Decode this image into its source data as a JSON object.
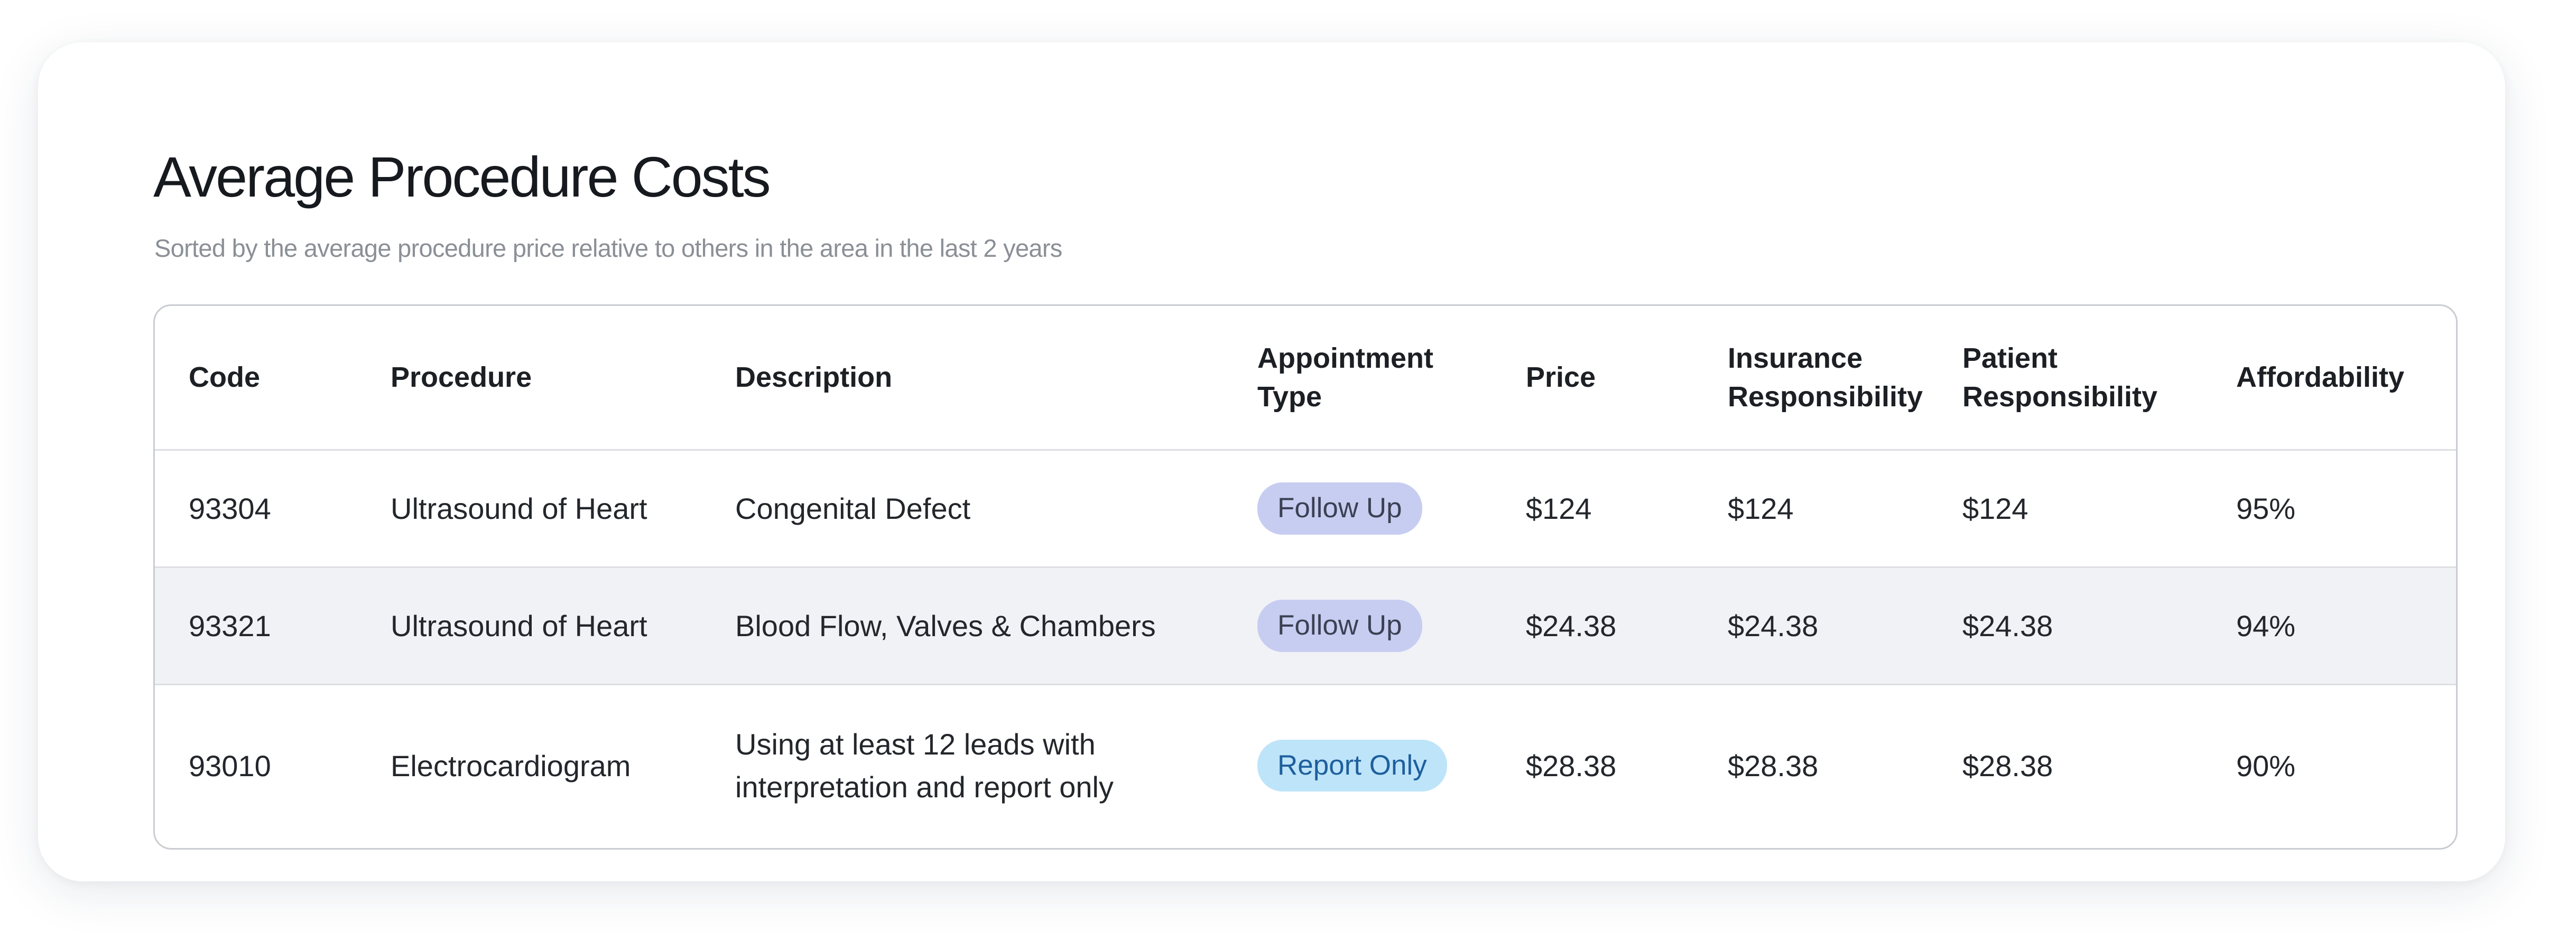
{
  "header": {
    "title": "Average Procedure Costs",
    "subtitle": "Sorted by the average procedure price relative to others in the area in the last 2 years"
  },
  "table": {
    "columns": [
      {
        "line1": "Code",
        "line2": ""
      },
      {
        "line1": "Procedure",
        "line2": ""
      },
      {
        "line1": "Description",
        "line2": ""
      },
      {
        "line1": "Appointment",
        "line2": "Type"
      },
      {
        "line1": "Price",
        "line2": ""
      },
      {
        "line1": "Insurance",
        "line2": "Responsibility"
      },
      {
        "line1": "Patient",
        "line2": "Responsibility"
      },
      {
        "line1": "Affordability",
        "line2": ""
      }
    ],
    "rows": [
      {
        "code": "93304",
        "procedure": "Ultrasound of Heart",
        "description_line1": "Congenital Defect",
        "description_line2": "",
        "appointment_type": "Follow Up",
        "price": "$124",
        "insurance": "$124",
        "patient": "$124",
        "affordability": "95%"
      },
      {
        "code": "93321",
        "procedure": "Ultrasound of Heart",
        "description_line1": "Blood Flow, Valves & Chambers",
        "description_line2": "",
        "appointment_type": "Follow Up",
        "price": "$24.38",
        "insurance": "$24.38",
        "patient": "$24.38",
        "affordability": "94%"
      },
      {
        "code": "93010",
        "procedure": "Electrocardiogram",
        "description_line1": "Using at least 12 leads with",
        "description_line2": "interpretation and report only",
        "appointment_type": "Report Only",
        "price": "$28.38",
        "insurance": "$28.38",
        "patient": "$28.38",
        "affordability": "90%"
      }
    ]
  },
  "colors": {
    "follow_up_badge_bg": "#c7cdf1",
    "follow_up_badge_text": "#3b4053",
    "report_only_badge_bg": "#bee4f9",
    "report_only_badge_text": "#1e5f9e",
    "alt_row_bg": "#f1f2f6"
  }
}
